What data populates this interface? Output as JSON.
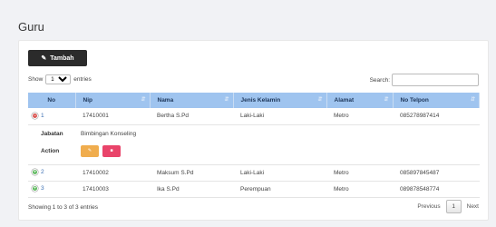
{
  "page": {
    "title": "Guru"
  },
  "toolbar": {
    "add_label": "Tambah",
    "add_icon": "edit-icon"
  },
  "length": {
    "show_label": "Show",
    "value": "10",
    "entries_label": "entries"
  },
  "search": {
    "label": "Search:",
    "value": ""
  },
  "table": {
    "headers": [
      "No",
      "Nip",
      "Nama",
      "Jenis Kelamin",
      "Alamat",
      "No Telpon"
    ],
    "rows": [
      {
        "no": "1",
        "nip": "17410001",
        "nama": "Bertha S.Pd",
        "jk": "Laki-Laki",
        "alamat": "Metro",
        "telp": "085278987414",
        "expanded": true
      },
      {
        "no": "2",
        "nip": "17410002",
        "nama": "Maksum S.Pd",
        "jk": "Laki-Laki",
        "alamat": "Metro",
        "telp": "085897845487",
        "expanded": false
      },
      {
        "no": "3",
        "nip": "17410003",
        "nama": "Ika S.Pd",
        "jk": "Perempuan",
        "alamat": "Metro",
        "telp": "089878548774",
        "expanded": false
      }
    ],
    "child": {
      "jabatan_label": "Jabatan",
      "jabatan_value": "Bimbingan Konseling",
      "action_label": "Action"
    }
  },
  "footer": {
    "info": "Showing 1 to 3 of 3 entries",
    "previous": "Previous",
    "page": "1",
    "next": "Next"
  },
  "colors": {
    "header_bg": "#9fc4ef",
    "edit": "#f0ad4e",
    "delete": "#e9446a",
    "expand_open": "#d9534f",
    "expand_closed": "#5cb85c"
  }
}
